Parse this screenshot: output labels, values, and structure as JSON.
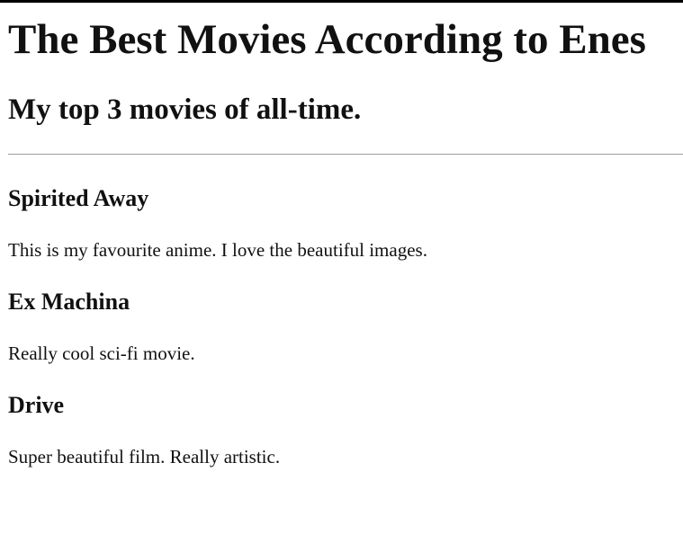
{
  "page": {
    "title": "The Best Movies According to Enes",
    "subtitle": "My top 3 movies of all-time."
  },
  "movies": [
    {
      "title": "Spirited Away",
      "description": "This is my favourite anime. I love the beautiful images."
    },
    {
      "title": "Ex Machina",
      "description": "Really cool sci-fi movie."
    },
    {
      "title": "Drive",
      "description": "Super beautiful film. Really artistic."
    }
  ]
}
